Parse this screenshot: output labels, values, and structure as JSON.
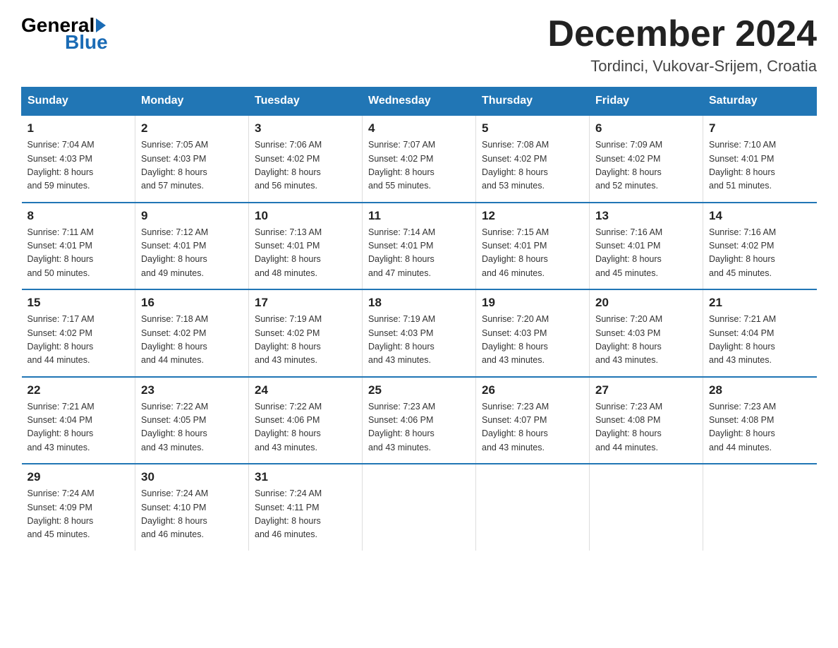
{
  "logo": {
    "general": "General",
    "blue": "Blue"
  },
  "header": {
    "month": "December 2024",
    "location": "Tordinci, Vukovar-Srijem, Croatia"
  },
  "days_of_week": [
    "Sunday",
    "Monday",
    "Tuesday",
    "Wednesday",
    "Thursday",
    "Friday",
    "Saturday"
  ],
  "weeks": [
    [
      {
        "day": "1",
        "sunrise": "7:04 AM",
        "sunset": "4:03 PM",
        "daylight": "8 hours and 59 minutes."
      },
      {
        "day": "2",
        "sunrise": "7:05 AM",
        "sunset": "4:03 PM",
        "daylight": "8 hours and 57 minutes."
      },
      {
        "day": "3",
        "sunrise": "7:06 AM",
        "sunset": "4:02 PM",
        "daylight": "8 hours and 56 minutes."
      },
      {
        "day": "4",
        "sunrise": "7:07 AM",
        "sunset": "4:02 PM",
        "daylight": "8 hours and 55 minutes."
      },
      {
        "day": "5",
        "sunrise": "7:08 AM",
        "sunset": "4:02 PM",
        "daylight": "8 hours and 53 minutes."
      },
      {
        "day": "6",
        "sunrise": "7:09 AM",
        "sunset": "4:02 PM",
        "daylight": "8 hours and 52 minutes."
      },
      {
        "day": "7",
        "sunrise": "7:10 AM",
        "sunset": "4:01 PM",
        "daylight": "8 hours and 51 minutes."
      }
    ],
    [
      {
        "day": "8",
        "sunrise": "7:11 AM",
        "sunset": "4:01 PM",
        "daylight": "8 hours and 50 minutes."
      },
      {
        "day": "9",
        "sunrise": "7:12 AM",
        "sunset": "4:01 PM",
        "daylight": "8 hours and 49 minutes."
      },
      {
        "day": "10",
        "sunrise": "7:13 AM",
        "sunset": "4:01 PM",
        "daylight": "8 hours and 48 minutes."
      },
      {
        "day": "11",
        "sunrise": "7:14 AM",
        "sunset": "4:01 PM",
        "daylight": "8 hours and 47 minutes."
      },
      {
        "day": "12",
        "sunrise": "7:15 AM",
        "sunset": "4:01 PM",
        "daylight": "8 hours and 46 minutes."
      },
      {
        "day": "13",
        "sunrise": "7:16 AM",
        "sunset": "4:01 PM",
        "daylight": "8 hours and 45 minutes."
      },
      {
        "day": "14",
        "sunrise": "7:16 AM",
        "sunset": "4:02 PM",
        "daylight": "8 hours and 45 minutes."
      }
    ],
    [
      {
        "day": "15",
        "sunrise": "7:17 AM",
        "sunset": "4:02 PM",
        "daylight": "8 hours and 44 minutes."
      },
      {
        "day": "16",
        "sunrise": "7:18 AM",
        "sunset": "4:02 PM",
        "daylight": "8 hours and 44 minutes."
      },
      {
        "day": "17",
        "sunrise": "7:19 AM",
        "sunset": "4:02 PM",
        "daylight": "8 hours and 43 minutes."
      },
      {
        "day": "18",
        "sunrise": "7:19 AM",
        "sunset": "4:03 PM",
        "daylight": "8 hours and 43 minutes."
      },
      {
        "day": "19",
        "sunrise": "7:20 AM",
        "sunset": "4:03 PM",
        "daylight": "8 hours and 43 minutes."
      },
      {
        "day": "20",
        "sunrise": "7:20 AM",
        "sunset": "4:03 PM",
        "daylight": "8 hours and 43 minutes."
      },
      {
        "day": "21",
        "sunrise": "7:21 AM",
        "sunset": "4:04 PM",
        "daylight": "8 hours and 43 minutes."
      }
    ],
    [
      {
        "day": "22",
        "sunrise": "7:21 AM",
        "sunset": "4:04 PM",
        "daylight": "8 hours and 43 minutes."
      },
      {
        "day": "23",
        "sunrise": "7:22 AM",
        "sunset": "4:05 PM",
        "daylight": "8 hours and 43 minutes."
      },
      {
        "day": "24",
        "sunrise": "7:22 AM",
        "sunset": "4:06 PM",
        "daylight": "8 hours and 43 minutes."
      },
      {
        "day": "25",
        "sunrise": "7:23 AM",
        "sunset": "4:06 PM",
        "daylight": "8 hours and 43 minutes."
      },
      {
        "day": "26",
        "sunrise": "7:23 AM",
        "sunset": "4:07 PM",
        "daylight": "8 hours and 43 minutes."
      },
      {
        "day": "27",
        "sunrise": "7:23 AM",
        "sunset": "4:08 PM",
        "daylight": "8 hours and 44 minutes."
      },
      {
        "day": "28",
        "sunrise": "7:23 AM",
        "sunset": "4:08 PM",
        "daylight": "8 hours and 44 minutes."
      }
    ],
    [
      {
        "day": "29",
        "sunrise": "7:24 AM",
        "sunset": "4:09 PM",
        "daylight": "8 hours and 45 minutes."
      },
      {
        "day": "30",
        "sunrise": "7:24 AM",
        "sunset": "4:10 PM",
        "daylight": "8 hours and 46 minutes."
      },
      {
        "day": "31",
        "sunrise": "7:24 AM",
        "sunset": "4:11 PM",
        "daylight": "8 hours and 46 minutes."
      },
      null,
      null,
      null,
      null
    ]
  ],
  "labels": {
    "sunrise": "Sunrise:",
    "sunset": "Sunset:",
    "daylight": "Daylight:"
  }
}
